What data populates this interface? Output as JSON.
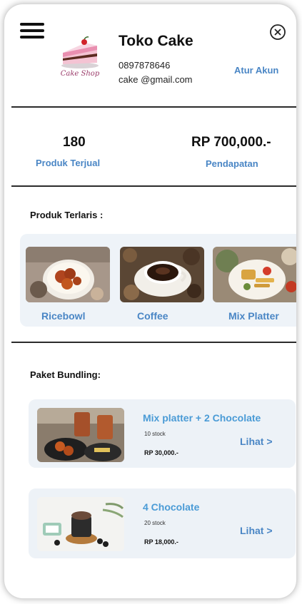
{
  "header": {
    "shop_name": "Toko Cake",
    "phone": "0897878646",
    "email": "cake @gmail.com",
    "logo_text": "Cake Shop",
    "account_link": "Atur Akun"
  },
  "stats": {
    "sold_value": "180",
    "sold_label": "Produk Terjual",
    "revenue_value": "RP 700,000.-",
    "revenue_label": "Pendapatan"
  },
  "best_sellers": {
    "title": "Produk Terlaris :",
    "items": [
      {
        "name": "Ricebowl"
      },
      {
        "name": "Coffee"
      },
      {
        "name": "Mix Platter"
      }
    ]
  },
  "bundles": {
    "title": "Paket Bundling:",
    "items": [
      {
        "name": "Mix platter + 2 Chocolate",
        "stock": "10 stock",
        "price": "RP 30,000.-",
        "link": "Lihat >"
      },
      {
        "name": "4 Chocolate",
        "stock": "20 stock",
        "price": "RP 18,000.-",
        "link": "Lihat >"
      }
    ]
  },
  "colors": {
    "accent": "#4a86c5",
    "card_background": "#edf2f7",
    "divider": "#2b2b2b"
  },
  "icons": [
    "hamburger-menu-icon",
    "close-circle-icon",
    "cake-logo"
  ]
}
